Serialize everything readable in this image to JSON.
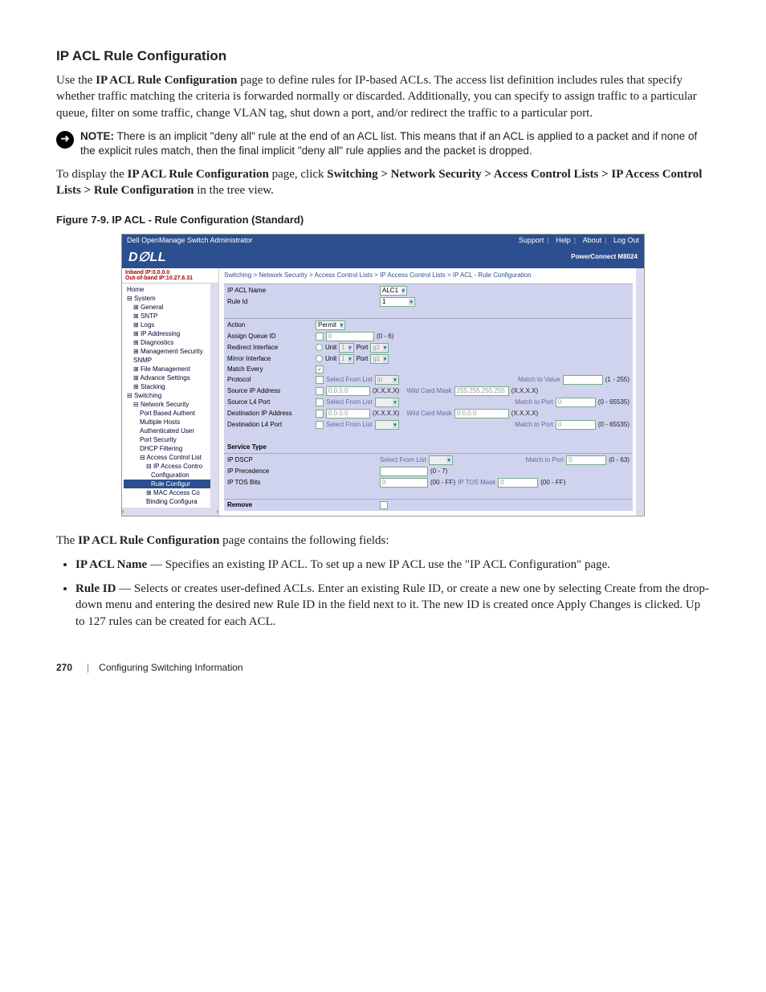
{
  "heading": "IP ACL Rule Configuration",
  "para1_a": "Use the ",
  "para1_b": "IP ACL Rule Configuration",
  "para1_c": " page to define rules for IP-based ACLs. The access list definition includes rules that specify whether traffic matching the criteria is forwarded normally or discarded. Additionally, you can specify to assign traffic to a particular queue, filter on some traffic, change VLAN tag, shut down a port, and/or redirect the traffic to a particular port.",
  "note_label": "NOTE:",
  "note_text": " There is an implicit \"deny all\" rule at the end of an ACL list. This means that if an ACL is applied to a packet and if none of the explicit rules match, then the final implicit \"deny all\" rule applies and the packet is dropped.",
  "para2_a": "To display the ",
  "para2_b": "IP ACL Rule Configuration",
  "para2_c": " page, click ",
  "para2_d": "Switching > Network Security > Access Control Lists > IP Access Control Lists > Rule Configuration",
  "para2_e": " in the tree view.",
  "figure_label": "Figure 7-9.    IP ACL - Rule Configuration (Standard)",
  "app": {
    "title": "Dell OpenManage Switch Administrator",
    "links": {
      "support": "Support",
      "help": "Help",
      "about": "About",
      "logout": "Log Out"
    },
    "product": "PowerConnect M8024",
    "ip_inband": "Inband IP:0.0.0.0",
    "ip_oob": "Out-of-band IP:10.27.6.31",
    "breadcrumb": "Switching > Network Security > Access Control Lists > IP Access Control Lists > IP ACL - Rule Configuration",
    "tree": {
      "home": "Home",
      "system": "System",
      "general": "General",
      "sntp": "SNTP",
      "logs": "Logs",
      "ipaddr": "IP Addressing",
      "diag": "Diagnostics",
      "mgmtsec": "Management Security",
      "snmp": "SNMP",
      "filemgmt": "File Management",
      "advset": "Advance Settings",
      "stacking": "Stacking",
      "switching": "Switching",
      "netsec": "Network Security",
      "pba": "Port Based Authent",
      "mhosts": "Multiple Hosts",
      "authusers": "Authenticated User",
      "portsec": "Port Security",
      "dhcpf": "DHCP Filtering",
      "acl": "Access Control List",
      "ipacl": "IP Access Contro",
      "config": "Configuration",
      "ruleconfig": "Rule Configur",
      "macacl": "MAC Access Co",
      "bindconf": "Binding Configura"
    },
    "fields": {
      "ip_acl_name": {
        "label": "IP ACL Name",
        "value": "ALC1"
      },
      "rule_id": {
        "label": "Rule Id",
        "value": "1"
      },
      "action": {
        "label": "Action",
        "value": "Permit"
      },
      "assign_queue": {
        "label": "Assign Queue ID",
        "value": "0",
        "hint": "(0 - 6)"
      },
      "redirect_if": {
        "label": "Redirect Interface",
        "unit_label": "Unit",
        "unit_value": "1",
        "port_label": "Port",
        "port_value": "g1"
      },
      "mirror_if": {
        "label": "Mirror Interface",
        "unit_label": "Unit",
        "unit_value": "1",
        "port_label": "Port",
        "port_value": "g1"
      },
      "match_every": {
        "label": "Match Every"
      },
      "protocol": {
        "label": "Protocol",
        "select_label": "Select From List",
        "select_value": "ip",
        "match_label": "Match to Value",
        "range": "(1 - 255)"
      },
      "src_ip": {
        "label": "Source IP Address",
        "value": "0.0.0.0",
        "fmt": "(X.X.X.X)",
        "mask_label": "Wild Card Mask",
        "mask_value": "255.255.255.255",
        "mask_fmt": "(X.X.X.X)"
      },
      "src_port": {
        "label": "Source L4 Port",
        "select_label": "Select From List",
        "match_label": "Match to Port",
        "match_value": "0",
        "range": "(0 - 65535)"
      },
      "dst_ip": {
        "label": "Destination IP Address",
        "value": "0.0.0.0",
        "fmt": "(X.X.X.X)",
        "mask_label": "Wild Card Mask",
        "mask_value": "0.0.0.0",
        "mask_fmt": "(X.X.X.X)"
      },
      "dst_port": {
        "label": "Destination L4 Port",
        "select_label": "Select From List",
        "match_label": "Match to Port",
        "match_value": "0",
        "range": "(0 - 65535)"
      },
      "service_type": "Service Type",
      "ip_dscp": {
        "label": "IP DSCP",
        "select_label": "Select From List",
        "match_label": "Match to Port",
        "match_value": "0",
        "range": "(0 - 63)"
      },
      "ip_prec": {
        "label": "IP Precedence",
        "hint": "(0 - 7)"
      },
      "ip_tos": {
        "label": "IP TOS Bits",
        "value": "0",
        "hint1": "(00 - FF)",
        "mask_label": "IP TOS Mask",
        "mask_value": "0",
        "hint2": "(00 - FF)"
      },
      "remove": "Remove"
    }
  },
  "post1_a": "The ",
  "post1_b": "IP ACL Rule Configuration",
  "post1_c": " page contains the following fields:",
  "bullets": [
    {
      "term": "IP ACL Name",
      "text": " — Specifies an existing IP ACL. To set up a new IP ACL use the \"IP ACL Configuration\" page."
    },
    {
      "term": "Rule ID",
      "text": " — Selects or creates user-defined ACLs. Enter an existing Rule ID, or create a new one by selecting Create from the drop-down menu and entering the desired new Rule ID in the field next to it. The new ID is created once Apply Changes is clicked. Up to 127 rules can be created for each ACL."
    }
  ],
  "footer": {
    "page": "270",
    "section": "Configuring Switching Information"
  }
}
